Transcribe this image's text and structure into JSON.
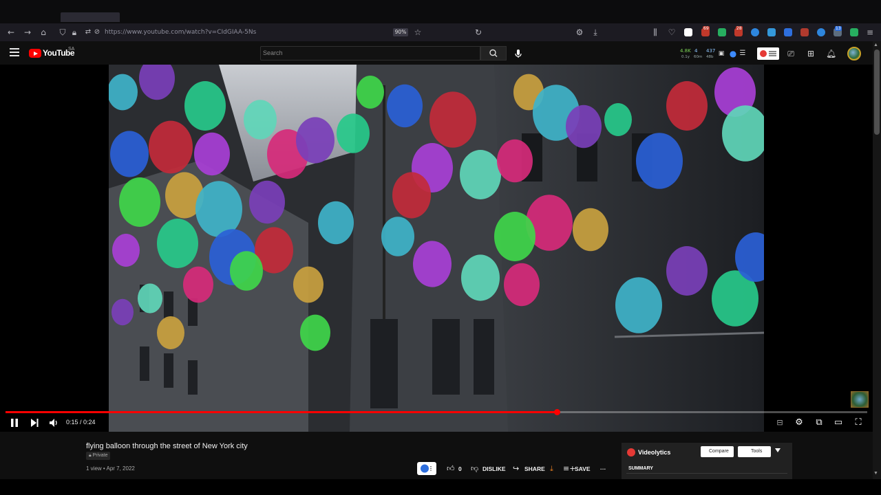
{
  "browser": {
    "url": "https://www.youtube.com/watch?v=CIdGIAA-5Ns",
    "zoom": "90%",
    "extension_badges": [
      "69",
      "28",
      "13"
    ]
  },
  "masthead": {
    "logo_text": "YouTube",
    "region_code": "SA",
    "search_placeholder": "Search",
    "stats": {
      "views_1": "4.8K",
      "views_1_sub": "0.1y",
      "likes": "4",
      "likes_sub": "60m",
      "count": "437",
      "count_sub": "48b"
    }
  },
  "player": {
    "time_current": "0:15",
    "time_sep": " / ",
    "time_total": "0:24",
    "progress": 0.64
  },
  "video": {
    "title": "flying balloon through the street of New York city",
    "privacy": "Private",
    "view_info": "1 view • Apr 7, 2022",
    "like_count": "0",
    "dislike_label": "DISLIKE",
    "share_label": "SHARE",
    "save_label": "SAVE",
    "more_label": "···"
  },
  "videolytics": {
    "title": "Videolytics",
    "compare_label": "Compare",
    "tools_label": "Tools",
    "summary_label": "SUMMARY"
  },
  "colors": {
    "accent": "#ff0000",
    "balloons": [
      "#3fb3c9",
      "#7a3fb8",
      "#27c98a",
      "#2a5fd6",
      "#c22a3a",
      "#a83fd6",
      "#5fd6b8",
      "#d62a7a",
      "#3fd64a",
      "#c9a13f"
    ]
  }
}
